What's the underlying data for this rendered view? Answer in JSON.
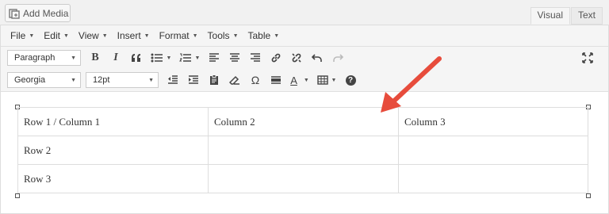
{
  "add_media": {
    "label": "Add Media",
    "icon": "media-icon"
  },
  "tabs": [
    {
      "label": "Visual",
      "active": true
    },
    {
      "label": "Text",
      "active": false
    }
  ],
  "menu": [
    {
      "label": "File"
    },
    {
      "label": "Edit"
    },
    {
      "label": "View"
    },
    {
      "label": "Insert"
    },
    {
      "label": "Format"
    },
    {
      "label": "Tools"
    },
    {
      "label": "Table"
    }
  ],
  "toolbar1": {
    "format_select": "Paragraph",
    "bold": "B",
    "italic": "I",
    "blockquote": "“",
    "icons": [
      "bold-icon",
      "italic-icon",
      "blockquote-icon",
      "bullet-list-icon",
      "numbered-list-icon",
      "align-left-icon",
      "align-center-icon",
      "align-right-icon",
      "link-icon",
      "unlink-icon",
      "undo-icon",
      "redo-icon",
      "fullscreen-icon"
    ]
  },
  "toolbar2": {
    "font_select": "Georgia",
    "size_select": "12pt",
    "omega": "Ω",
    "text_color": "A",
    "help": "?",
    "icons": [
      "outdent-icon",
      "indent-icon",
      "paste-text-icon",
      "clear-format-icon",
      "special-char-icon",
      "horizontal-line-icon",
      "text-color-icon",
      "table-icon",
      "help-icon"
    ]
  },
  "table": {
    "rows": [
      [
        "Row 1 / Column 1",
        "Column 2",
        "Column 3"
      ],
      [
        "Row 2",
        "",
        ""
      ],
      [
        "Row 3",
        "",
        ""
      ]
    ]
  },
  "colors": {
    "arrow": "#e74c3c"
  }
}
